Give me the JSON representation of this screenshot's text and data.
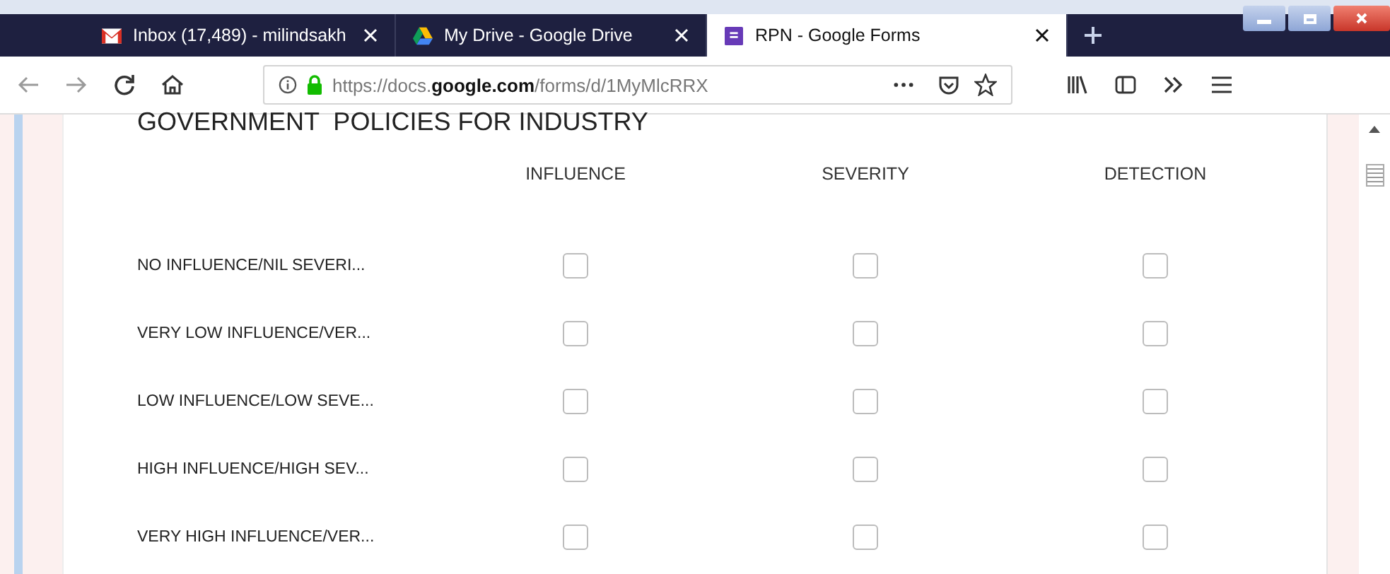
{
  "tabs": [
    {
      "title": "Inbox (17,489) - milindsakh",
      "selected": false
    },
    {
      "title": "My Drive - Google Drive",
      "selected": false
    },
    {
      "title": "RPN - Google Forms",
      "selected": true
    }
  ],
  "address_bar": {
    "url": "https://docs.**google.com**/forms/d/1MyMlcRRX"
  },
  "form": {
    "question": "GOVERNMENT  POLICIES FOR INDUSTRY",
    "columns": [
      "INFLUENCE",
      "SEVERITY",
      "DETECTION"
    ],
    "rows": [
      {
        "label": "NO INFLUENCE/NIL SEVERI...",
        "checked": [
          false,
          false,
          false
        ]
      },
      {
        "label": "VERY LOW INFLUENCE/VER...",
        "checked": [
          false,
          false,
          false
        ]
      },
      {
        "label": "LOW INFLUENCE/LOW SEVE...",
        "checked": [
          false,
          false,
          false
        ]
      },
      {
        "label": "HIGH INFLUENCE/HIGH SEV...",
        "checked": [
          false,
          false,
          false
        ]
      },
      {
        "label": "VERY HIGH INFLUENCE/VER...",
        "checked": [
          false,
          false,
          false
        ]
      }
    ]
  }
}
